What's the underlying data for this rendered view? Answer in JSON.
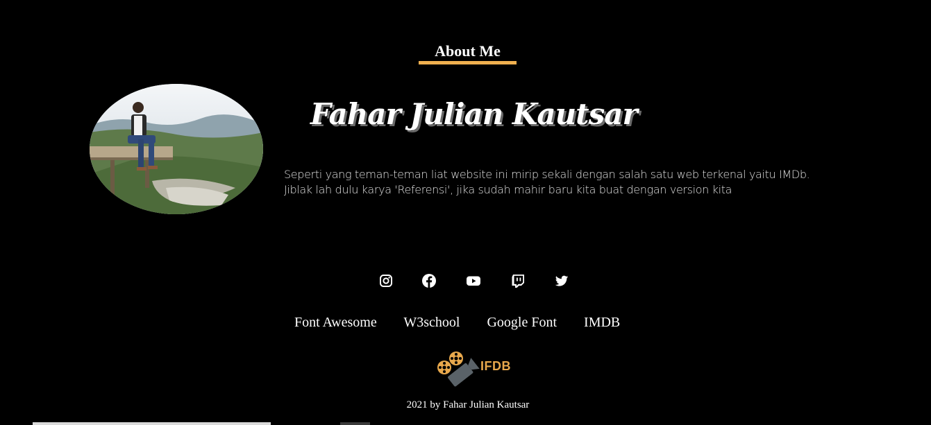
{
  "about": {
    "section_title": "About Me",
    "name": "Fahar Julian Kautsar",
    "bio_line_1": "Seperti yang teman-teman liat website ini mirip sekali dengan salah satu web terkenal yaitu IMDb.",
    "bio_line_2": "Jiblak lah dulu karya 'Referensi', jika sudah mahir baru kita buat dengan version kita"
  },
  "social": [
    {
      "icon": "instagram-icon"
    },
    {
      "icon": "facebook-icon"
    },
    {
      "icon": "youtube-icon"
    },
    {
      "icon": "twitch-icon"
    },
    {
      "icon": "twitter-icon"
    }
  ],
  "footer": {
    "links": [
      "Font Awesome",
      "W3school",
      "Google Font",
      "IMDB"
    ],
    "logo_text": "IFDB",
    "copyright": "2021 by Fahar Julian Kautsar"
  },
  "colors": {
    "background": "#000000",
    "accent": "#f0b04f",
    "logo_gold": "#e8a84c",
    "text": "#ffffff"
  }
}
